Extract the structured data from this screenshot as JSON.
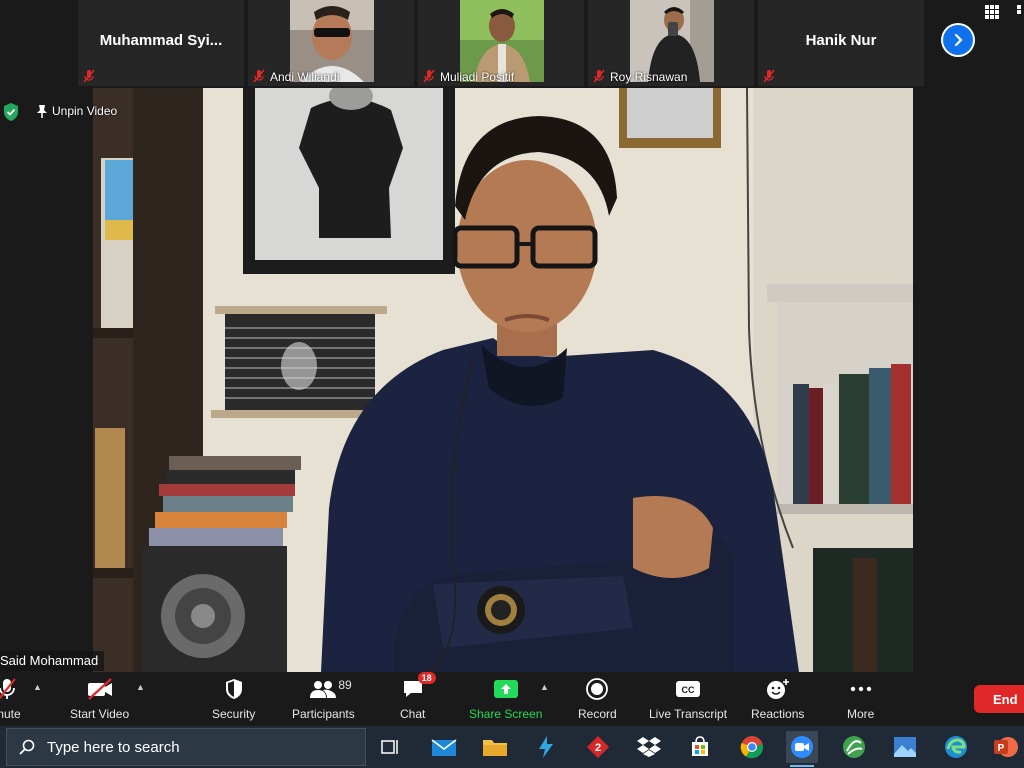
{
  "participants": [
    {
      "name": "Muhammad  Syi...",
      "video": false
    },
    {
      "name": "Andi Wiliandi",
      "video": true
    },
    {
      "name": "Muliadi Positif",
      "video": true
    },
    {
      "name": "Roy Risnawan",
      "video": true
    },
    {
      "name": "Hanik Nur",
      "video": false
    }
  ],
  "main": {
    "unpin_label": "Unpin Video",
    "speaker_name": "Said Mohammad"
  },
  "toolbar": {
    "mute_label": "mute",
    "start_video_label": "Start Video",
    "security_label": "Security",
    "participants_label": "Participants",
    "participants_count": "89",
    "chat_label": "Chat",
    "chat_badge": "18",
    "share_label": "Share Screen",
    "record_label": "Record",
    "transcript_label": "Live Transcript",
    "reactions_label": "Reactions",
    "more_label": "More",
    "end_label": "End"
  },
  "taskbar": {
    "search_placeholder": "Type here to search"
  },
  "colors": {
    "accent_blue": "#0e72ed",
    "share_green": "#23d959",
    "end_red": "#e02828",
    "mute_red": "#e02828"
  }
}
